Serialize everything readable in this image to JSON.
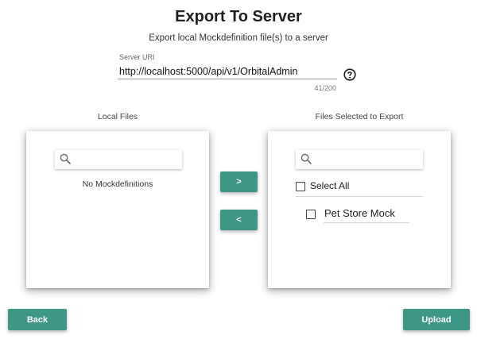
{
  "header": {
    "title": "Export To Server",
    "subtitle": "Export local Mockdefinition file(s) to a server"
  },
  "server_uri": {
    "label": "Server URI",
    "value": "http://localhost:5000/api/v1/OrbitalAdmin",
    "counter": "41/200"
  },
  "local_files": {
    "label": "Local Files",
    "search_placeholder": "",
    "empty_message": "No Mockdefinitions"
  },
  "transfer": {
    "move_right_label": ">",
    "move_left_label": "<"
  },
  "selected_files": {
    "label": "Files Selected to Export",
    "search_placeholder": "",
    "select_all_label": "Select All",
    "items": [
      {
        "label": "Pet Store Mock",
        "checked": false
      }
    ]
  },
  "footer": {
    "back_label": "Back",
    "upload_label": "Upload"
  },
  "colors": {
    "accent": "#3e9686"
  },
  "icons": {
    "search": "search-icon",
    "help": "help-circle-icon"
  }
}
